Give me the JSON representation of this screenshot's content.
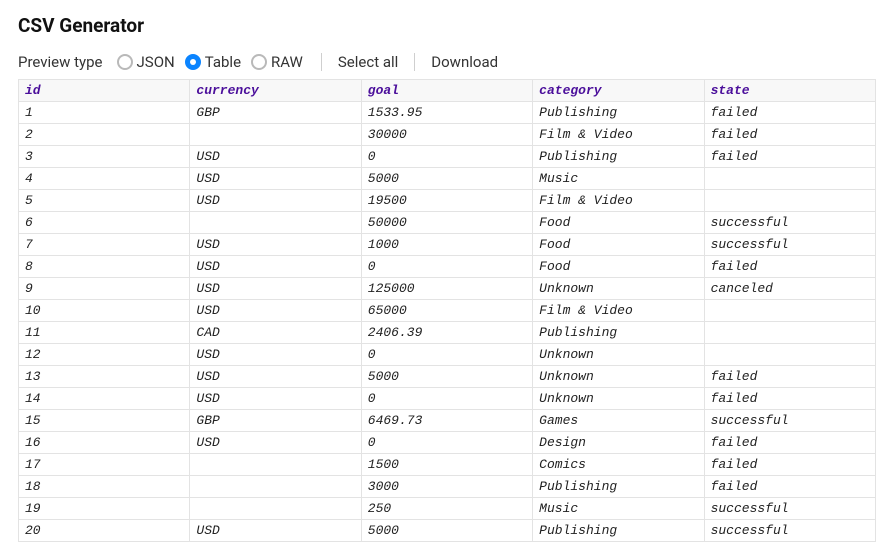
{
  "title": "CSV Generator",
  "toolbar": {
    "preview_type_label": "Preview type",
    "radios": [
      {
        "label": "JSON",
        "selected": false
      },
      {
        "label": "Table",
        "selected": true
      },
      {
        "label": "RAW",
        "selected": false
      }
    ],
    "select_all": "Select all",
    "download": "Download"
  },
  "table": {
    "headers": [
      "id",
      "currency",
      "goal",
      "category",
      "state"
    ],
    "rows": [
      {
        "id": "1",
        "currency": "GBP",
        "goal": "1533.95",
        "category": "Publishing",
        "state": "failed"
      },
      {
        "id": "2",
        "currency": "",
        "goal": "30000",
        "category": "Film & Video",
        "state": "failed"
      },
      {
        "id": "3",
        "currency": "USD",
        "goal": "0",
        "category": "Publishing",
        "state": "failed"
      },
      {
        "id": "4",
        "currency": "USD",
        "goal": "5000",
        "category": "Music",
        "state": ""
      },
      {
        "id": "5",
        "currency": "USD",
        "goal": "19500",
        "category": "Film & Video",
        "state": ""
      },
      {
        "id": "6",
        "currency": "",
        "goal": "50000",
        "category": "Food",
        "state": "successful"
      },
      {
        "id": "7",
        "currency": "USD",
        "goal": "1000",
        "category": "Food",
        "state": "successful"
      },
      {
        "id": "8",
        "currency": "USD",
        "goal": "0",
        "category": "Food",
        "state": "failed"
      },
      {
        "id": "9",
        "currency": "USD",
        "goal": "125000",
        "category": "Unknown",
        "state": "canceled"
      },
      {
        "id": "10",
        "currency": "USD",
        "goal": "65000",
        "category": "Film & Video",
        "state": ""
      },
      {
        "id": "11",
        "currency": "CAD",
        "goal": "2406.39",
        "category": "Publishing",
        "state": ""
      },
      {
        "id": "12",
        "currency": "USD",
        "goal": "0",
        "category": "Unknown",
        "state": ""
      },
      {
        "id": "13",
        "currency": "USD",
        "goal": "5000",
        "category": "Unknown",
        "state": "failed"
      },
      {
        "id": "14",
        "currency": "USD",
        "goal": "0",
        "category": "Unknown",
        "state": "failed"
      },
      {
        "id": "15",
        "currency": "GBP",
        "goal": "6469.73",
        "category": "Games",
        "state": "successful"
      },
      {
        "id": "16",
        "currency": "USD",
        "goal": "0",
        "category": "Design",
        "state": "failed"
      },
      {
        "id": "17",
        "currency": "",
        "goal": "1500",
        "category": "Comics",
        "state": "failed"
      },
      {
        "id": "18",
        "currency": "",
        "goal": "3000",
        "category": "Publishing",
        "state": "failed"
      },
      {
        "id": "19",
        "currency": "",
        "goal": "250",
        "category": "Music",
        "state": "successful"
      },
      {
        "id": "20",
        "currency": "USD",
        "goal": "5000",
        "category": "Publishing",
        "state": "successful"
      }
    ]
  }
}
